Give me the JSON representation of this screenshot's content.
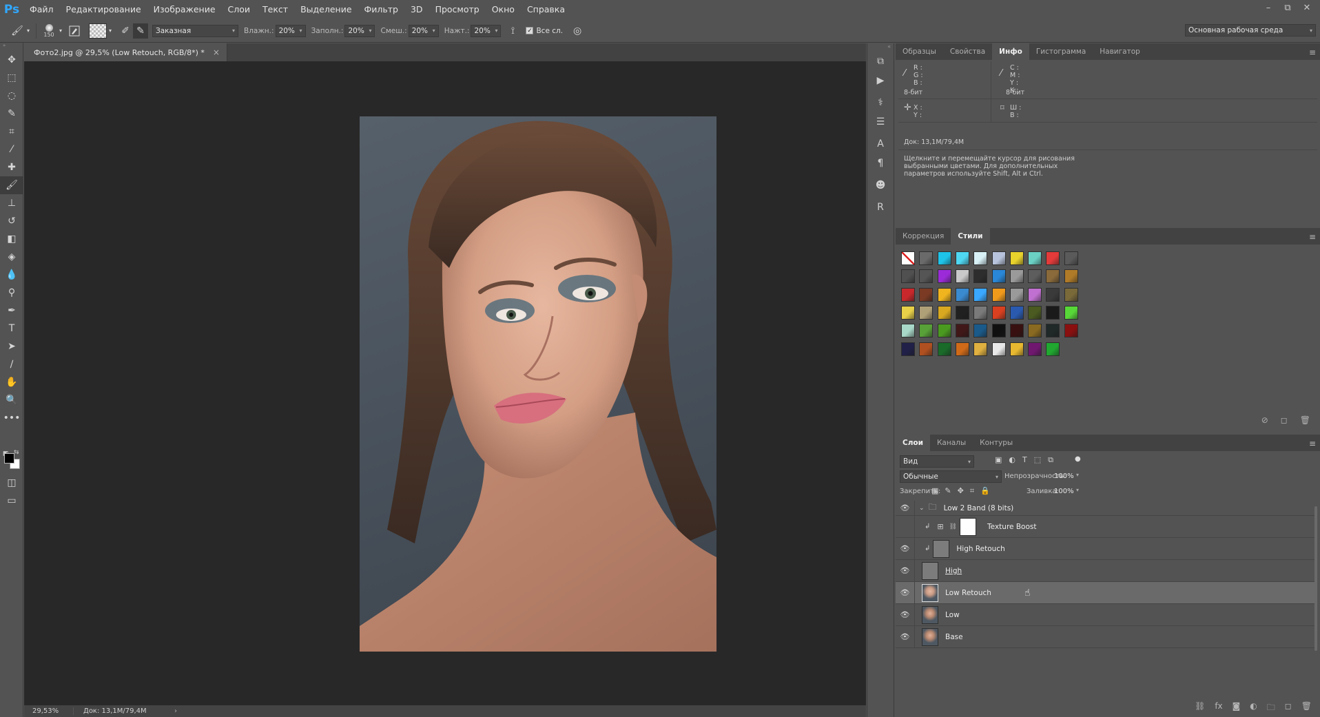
{
  "app": {
    "logo": "Ps"
  },
  "menu": [
    "Файл",
    "Редактирование",
    "Изображение",
    "Слои",
    "Текст",
    "Выделение",
    "Фильтр",
    "3D",
    "Просмотр",
    "Окно",
    "Справка"
  ],
  "window_controls": {
    "minimize": "–",
    "restore": "⧉",
    "close": "✕"
  },
  "options": {
    "brush_size": "150",
    "preset": "Заказная",
    "wet_label": "Влажн.:",
    "wet_value": "20%",
    "load_label": "Заполн.:",
    "load_value": "20%",
    "mix_label": "Смеш.:",
    "mix_value": "20%",
    "flow_label": "Нажт.:",
    "flow_value": "20%",
    "all_layers_label": "Все сл.",
    "workspace": "Основная рабочая среда"
  },
  "document": {
    "tab_title": "Фото2.jpg @ 29,5% (Low Retouch, RGB/8*) *",
    "tab_close": "×",
    "zoom": "29,53%",
    "doc_size": "Док: 13,1M/79,4M"
  },
  "info_panel": {
    "tabs": [
      "Образцы",
      "Свойства",
      "Инфо",
      "Гистограмма",
      "Навигатор"
    ],
    "active_tab": 2,
    "rgb_labels": "R :\nG :\nB :",
    "cmyk_labels": "C :\nM :\nY :\nK :",
    "bit_left": "8-бит",
    "bit_right": "8-бит",
    "xy_labels": "X :\nY :",
    "wh_labels": "Ш :\nB :",
    "doc_size": "Док: 13,1M/79,4M",
    "hint": "Щелкните и перемещайте курсор для рисования выбранными цветами. Для дополнительных параметров используйте Shift, Alt и Ctrl."
  },
  "styles_panel": {
    "tabs": [
      "Коррекция",
      "Стили"
    ],
    "active_tab": 1,
    "swatch_colors": [
      "#ffffff",
      "#6a6a6a",
      "#1ec3e8",
      "#4fd7f2",
      "#d8f1f7",
      "#b7c3dc",
      "#e8d22c",
      "#6bd1c5",
      "#e33a3a",
      "#5a5a5a",
      "#505050",
      "#555555",
      "#9b2bd8",
      "#c9c9c9",
      "#2d2d2d",
      "#2a86d6",
      "#9a9a9a",
      "#5d5d5d",
      "#8a6a3a",
      "#b07b28",
      "#c8282b",
      "#7a3a24",
      "#f0b41e",
      "#3a8ad0",
      "#3aa8ff",
      "#f09a1c",
      "#9a9a9a",
      "#c070d0",
      "#3a3a3a",
      "#7a6a3a",
      "#e8d048",
      "#b0a078",
      "#d8a820",
      "#202020",
      "#7a7a7a",
      "#d84020",
      "#2a5ab0",
      "#4a5a20",
      "#1a1a1a",
      "#58d838",
      "#a8d8c8",
      "#58a038",
      "#4a9a20",
      "#401818",
      "#1a5a8a",
      "#101010",
      "#381010",
      "#8a6a20",
      "#202828",
      "#8a1010",
      "#202048",
      "#b05020",
      "#1a6a2a",
      "#d06a18",
      "#e0b040",
      "#e8e8e8",
      "#e8b830",
      "#701870",
      "#20a830"
    ]
  },
  "layers_panel": {
    "tabs": [
      "Слои",
      "Каналы",
      "Контуры"
    ],
    "active_tab": 0,
    "filter_kind": "Вид",
    "blend_mode": "Обычные",
    "opacity_label": "Непрозрачность:",
    "opacity_value": "100%",
    "lock_label": "Закрепить:",
    "fill_label": "Заливка:",
    "fill_value": "100%",
    "layers": [
      {
        "name": "Low 2 Band (8 bits)",
        "type": "group",
        "visible": true
      },
      {
        "name": "Texture Boost",
        "type": "adjustment",
        "visible": false
      },
      {
        "name": "High Retouch",
        "type": "clipped",
        "visible": true
      },
      {
        "name": "High",
        "type": "gray",
        "visible": true
      },
      {
        "name": "Low Retouch",
        "type": "photo",
        "visible": true,
        "selected": true
      },
      {
        "name": "Low",
        "type": "photo",
        "visible": true
      },
      {
        "name": "Base",
        "type": "photo",
        "visible": true
      }
    ]
  }
}
